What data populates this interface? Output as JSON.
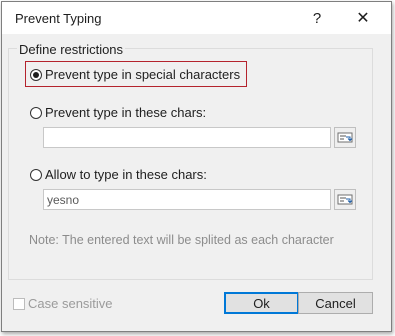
{
  "window": {
    "title": "Prevent Typing",
    "help_glyph": "?",
    "close_glyph": "✕"
  },
  "group": {
    "legend": "Define restrictions"
  },
  "options": [
    {
      "label": "Prevent type in special characters",
      "checked": true
    },
    {
      "label": "Prevent type in these chars:",
      "checked": false,
      "value": "",
      "placeholder": ""
    },
    {
      "label": "Allow to type in these chars:",
      "checked": false,
      "value": "yesno",
      "placeholder": ""
    }
  ],
  "note": "Note: The entered text will be splited as each character",
  "case_sensitive": {
    "label": "Case sensitive",
    "checked": false,
    "enabled": false
  },
  "buttons": {
    "ok": "Ok",
    "cancel": "Cancel"
  },
  "colors": {
    "focus_border": "#b4232d",
    "default_button_border": "#0078d7"
  },
  "icons": {
    "help": "question-mark-icon",
    "close": "close-icon",
    "picker": "character-picker-icon"
  }
}
